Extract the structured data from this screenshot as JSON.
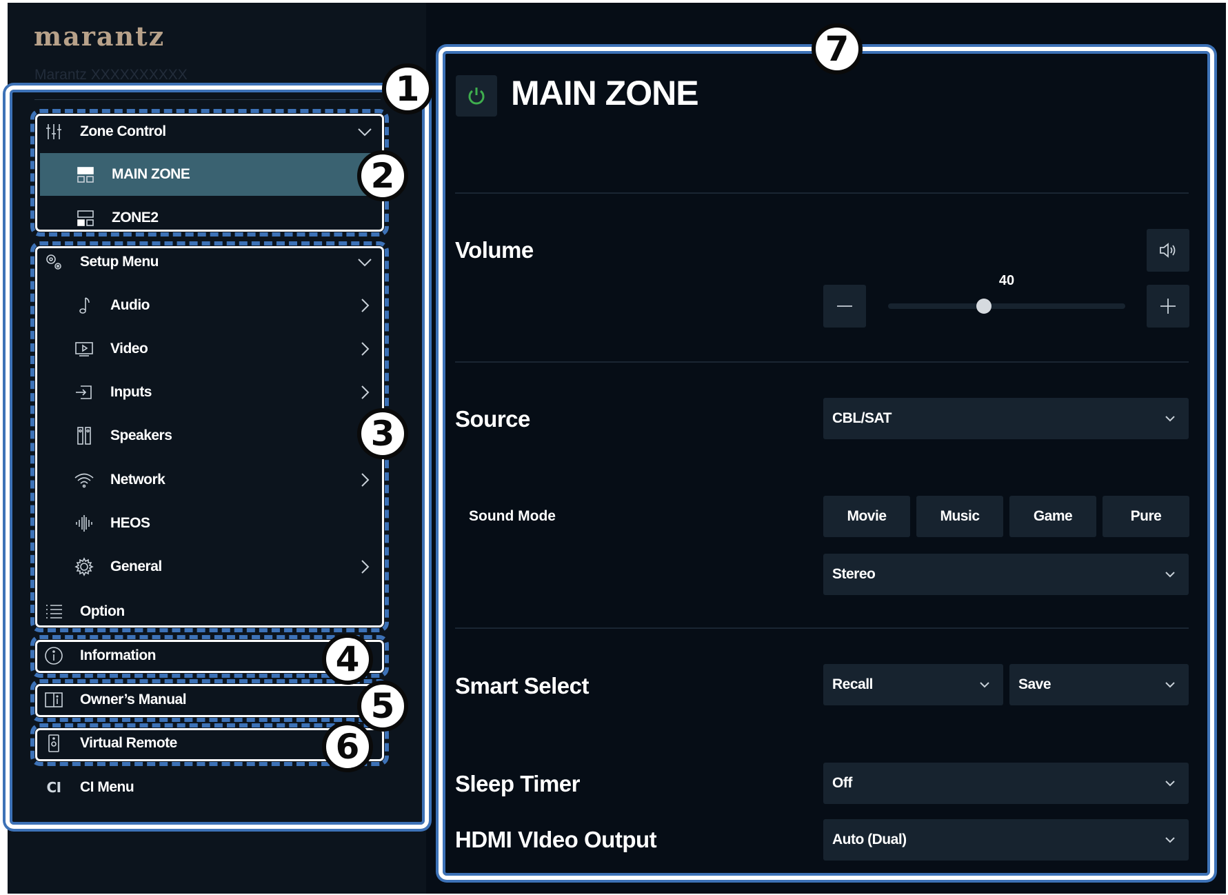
{
  "app": {
    "brand_logo": "marantz",
    "model_name": "Marantz XXXXXXXXXX"
  },
  "annotations": [
    "1",
    "2",
    "3",
    "4",
    "5",
    "6",
    "7"
  ],
  "sidebar": {
    "zone_control": {
      "label": "Zone Control",
      "icon": "sliders-icon",
      "items": [
        {
          "label": "MAIN ZONE",
          "icon": "zone-icon",
          "active": true
        },
        {
          "label": "ZONE2",
          "icon": "zone-icon",
          "active": false
        }
      ]
    },
    "setup_menu": {
      "label": "Setup Menu",
      "icon": "gears-icon",
      "items": [
        {
          "label": "Audio",
          "icon": "music-note-icon",
          "has_submenu": true
        },
        {
          "label": "Video",
          "icon": "video-icon",
          "has_submenu": true
        },
        {
          "label": "Inputs",
          "icon": "input-icon",
          "has_submenu": true
        },
        {
          "label": "Speakers",
          "icon": "speakers-icon",
          "has_submenu": false
        },
        {
          "label": "Network",
          "icon": "wifi-icon",
          "has_submenu": true
        },
        {
          "label": "HEOS",
          "icon": "heos-icon",
          "has_submenu": false
        },
        {
          "label": "General",
          "icon": "gear-icon",
          "has_submenu": true
        }
      ]
    },
    "option": {
      "label": "Option",
      "icon": "list-icon"
    },
    "information": {
      "label": "Information",
      "icon": "info-icon"
    },
    "owners_manual": {
      "label": "Owner’s Manual",
      "icon": "book-icon"
    },
    "virtual_remote": {
      "label": "Virtual Remote",
      "icon": "remote-icon"
    },
    "ci_menu": {
      "icon_text": "CI",
      "label": "CI Menu"
    }
  },
  "main": {
    "title": "MAIN ZONE",
    "power_color": "#3fae4e",
    "volume": {
      "label": "Volume",
      "value": "40",
      "level_fraction": 0.4,
      "mute_icon": "speaker-icon"
    },
    "source": {
      "label": "Source",
      "selected": "CBL/SAT"
    },
    "sound_mode": {
      "label": "Sound Mode",
      "buttons": [
        "Movie",
        "Music",
        "Game",
        "Pure"
      ],
      "selected": "Stereo"
    },
    "smart_select": {
      "label": "Smart Select",
      "recall": "Recall",
      "save": "Save"
    },
    "sleep_timer": {
      "label": "Sleep Timer",
      "selected": "Off"
    },
    "hdmi_video_output": {
      "label": "HDMI VIdeo Output",
      "selected": "Auto (Dual)"
    }
  },
  "colors": {
    "accent_active": "#3a6271",
    "annotation_blue": "#3d72b7",
    "sidebar_bg": "#0c141d",
    "main_bg": "#060d16",
    "control_bg": "#17232f"
  }
}
